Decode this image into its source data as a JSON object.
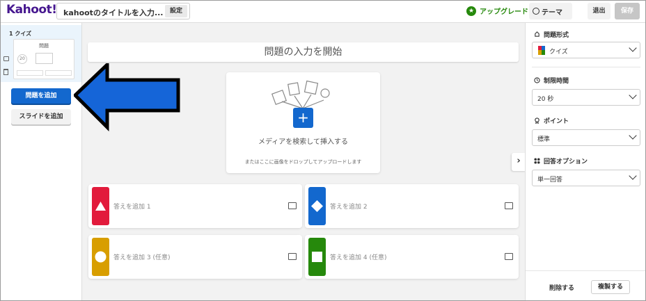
{
  "header": {
    "logo": "Kahoot!",
    "title": "kahootのタイトルを入力...",
    "settings_label": "設定",
    "upgrade_label": "アップグレード",
    "theme_label": "テーマ",
    "exit_label": "退出",
    "save_label": "保存"
  },
  "sidebar": {
    "slide_label": "1  クイズ",
    "thumb_title": "問題",
    "thumb_timer": "20",
    "add_question_label": "問題を追加",
    "add_slide_label": "スライドを追加"
  },
  "editor": {
    "question_placeholder": "問題の入力を開始",
    "media_label": "メディアを検索して挿入する",
    "media_sub": "またはここに画像をドロップしてアップロードします",
    "answers": [
      {
        "label": "答えを追加 1",
        "color": "#e21b3c"
      },
      {
        "label": "答えを追加 2",
        "color": "#1368ce"
      },
      {
        "label": "答えを追加 3 (任意)",
        "color": "#d89e00"
      },
      {
        "label": "答えを追加 4 (任意)",
        "color": "#26890c"
      }
    ]
  },
  "settings": {
    "type_heading": "問題形式",
    "type_value": "クイズ",
    "time_heading": "制限時間",
    "time_value": "20 秒",
    "points_heading": "ポイント",
    "points_value": "標準",
    "answer_heading": "回答オプション",
    "answer_value": "単一回答",
    "delete_label": "削除する",
    "copy_label": "複製する"
  },
  "colors": {
    "brand": "#46178f",
    "primary_blue": "#1368ce",
    "green": "#26890c"
  }
}
